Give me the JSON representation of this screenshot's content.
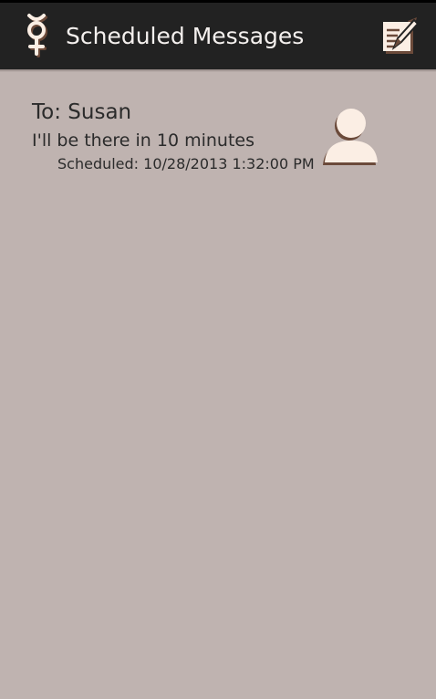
{
  "app": {
    "title": "Scheduled Messages",
    "icon": "mercury-symbol-icon",
    "action_icon": "compose-icon"
  },
  "messages": [
    {
      "to_label": "To:",
      "recipient": "Susan",
      "body": "I'll be there in 10 minutes",
      "scheduled_label": "Scheduled:",
      "scheduled_time": "10/28/2013 1:32:00 PM",
      "avatar": "contact-avatar-icon"
    }
  ],
  "colors": {
    "action_bar": "#222222",
    "background": "#bfb3b0",
    "icon_fill": "#fbeee4",
    "icon_shadow": "#6b4a3a",
    "text": "#2b2b2b",
    "title_text": "#f4f0ee"
  }
}
